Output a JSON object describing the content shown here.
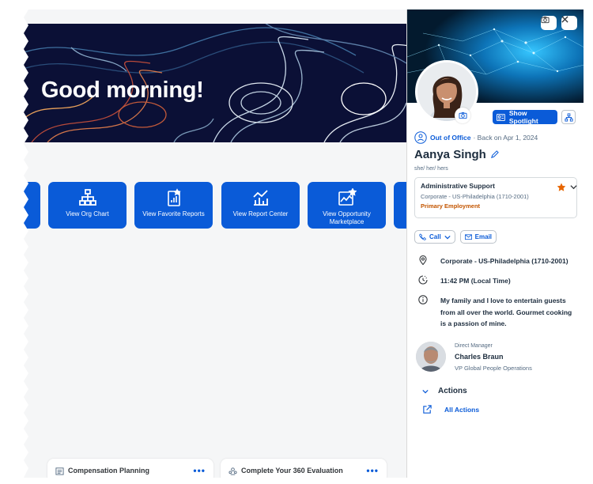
{
  "home": {
    "greeting": "Good morning!",
    "tiles": [
      {
        "label": "View Org Chart",
        "icon": "org-chart-icon"
      },
      {
        "label": "View Favorite Reports",
        "icon": "favorite-reports-icon"
      },
      {
        "label": "View Report Center",
        "icon": "report-center-icon"
      },
      {
        "label": "View Opportunity Marketplace",
        "icon": "opportunity-marketplace-icon"
      }
    ],
    "cards": [
      {
        "title": "Compensation Planning",
        "icon": "compensation-icon"
      },
      {
        "title": "Complete Your 360 Evaluation",
        "icon": "evaluation-icon"
      }
    ]
  },
  "profile": {
    "spotlight_label": "Show Spotlight",
    "status": "Out of Office",
    "status_detail": "· Back on Apr 1, 2024",
    "name": "Aanya Singh",
    "pronouns": "she/ her/ hers",
    "job": {
      "title": "Administrative Support",
      "location": "Corporate - US-Philadelphia (1710-2001)",
      "employment": "Primary Employment"
    },
    "contact": {
      "call_label": "Call",
      "email_label": "Email"
    },
    "location": "Corporate - US-Philadelphia (1710-2001)",
    "local_time": "11:42 PM (Local Time)",
    "bio": "My family and I love to entertain guests from all over the world. Gourmet cooking is a passion of mine.",
    "manager": {
      "role": "Direct Manager",
      "name": "Charles Braun",
      "title": "VP Global People Operations"
    },
    "actions_heading": "Actions",
    "all_actions_label": "All Actions"
  },
  "colors": {
    "accent": "#0a5bd8",
    "banner": "#0b1036",
    "favorite_star": "#e76500",
    "primary_employment": "#c35500"
  }
}
